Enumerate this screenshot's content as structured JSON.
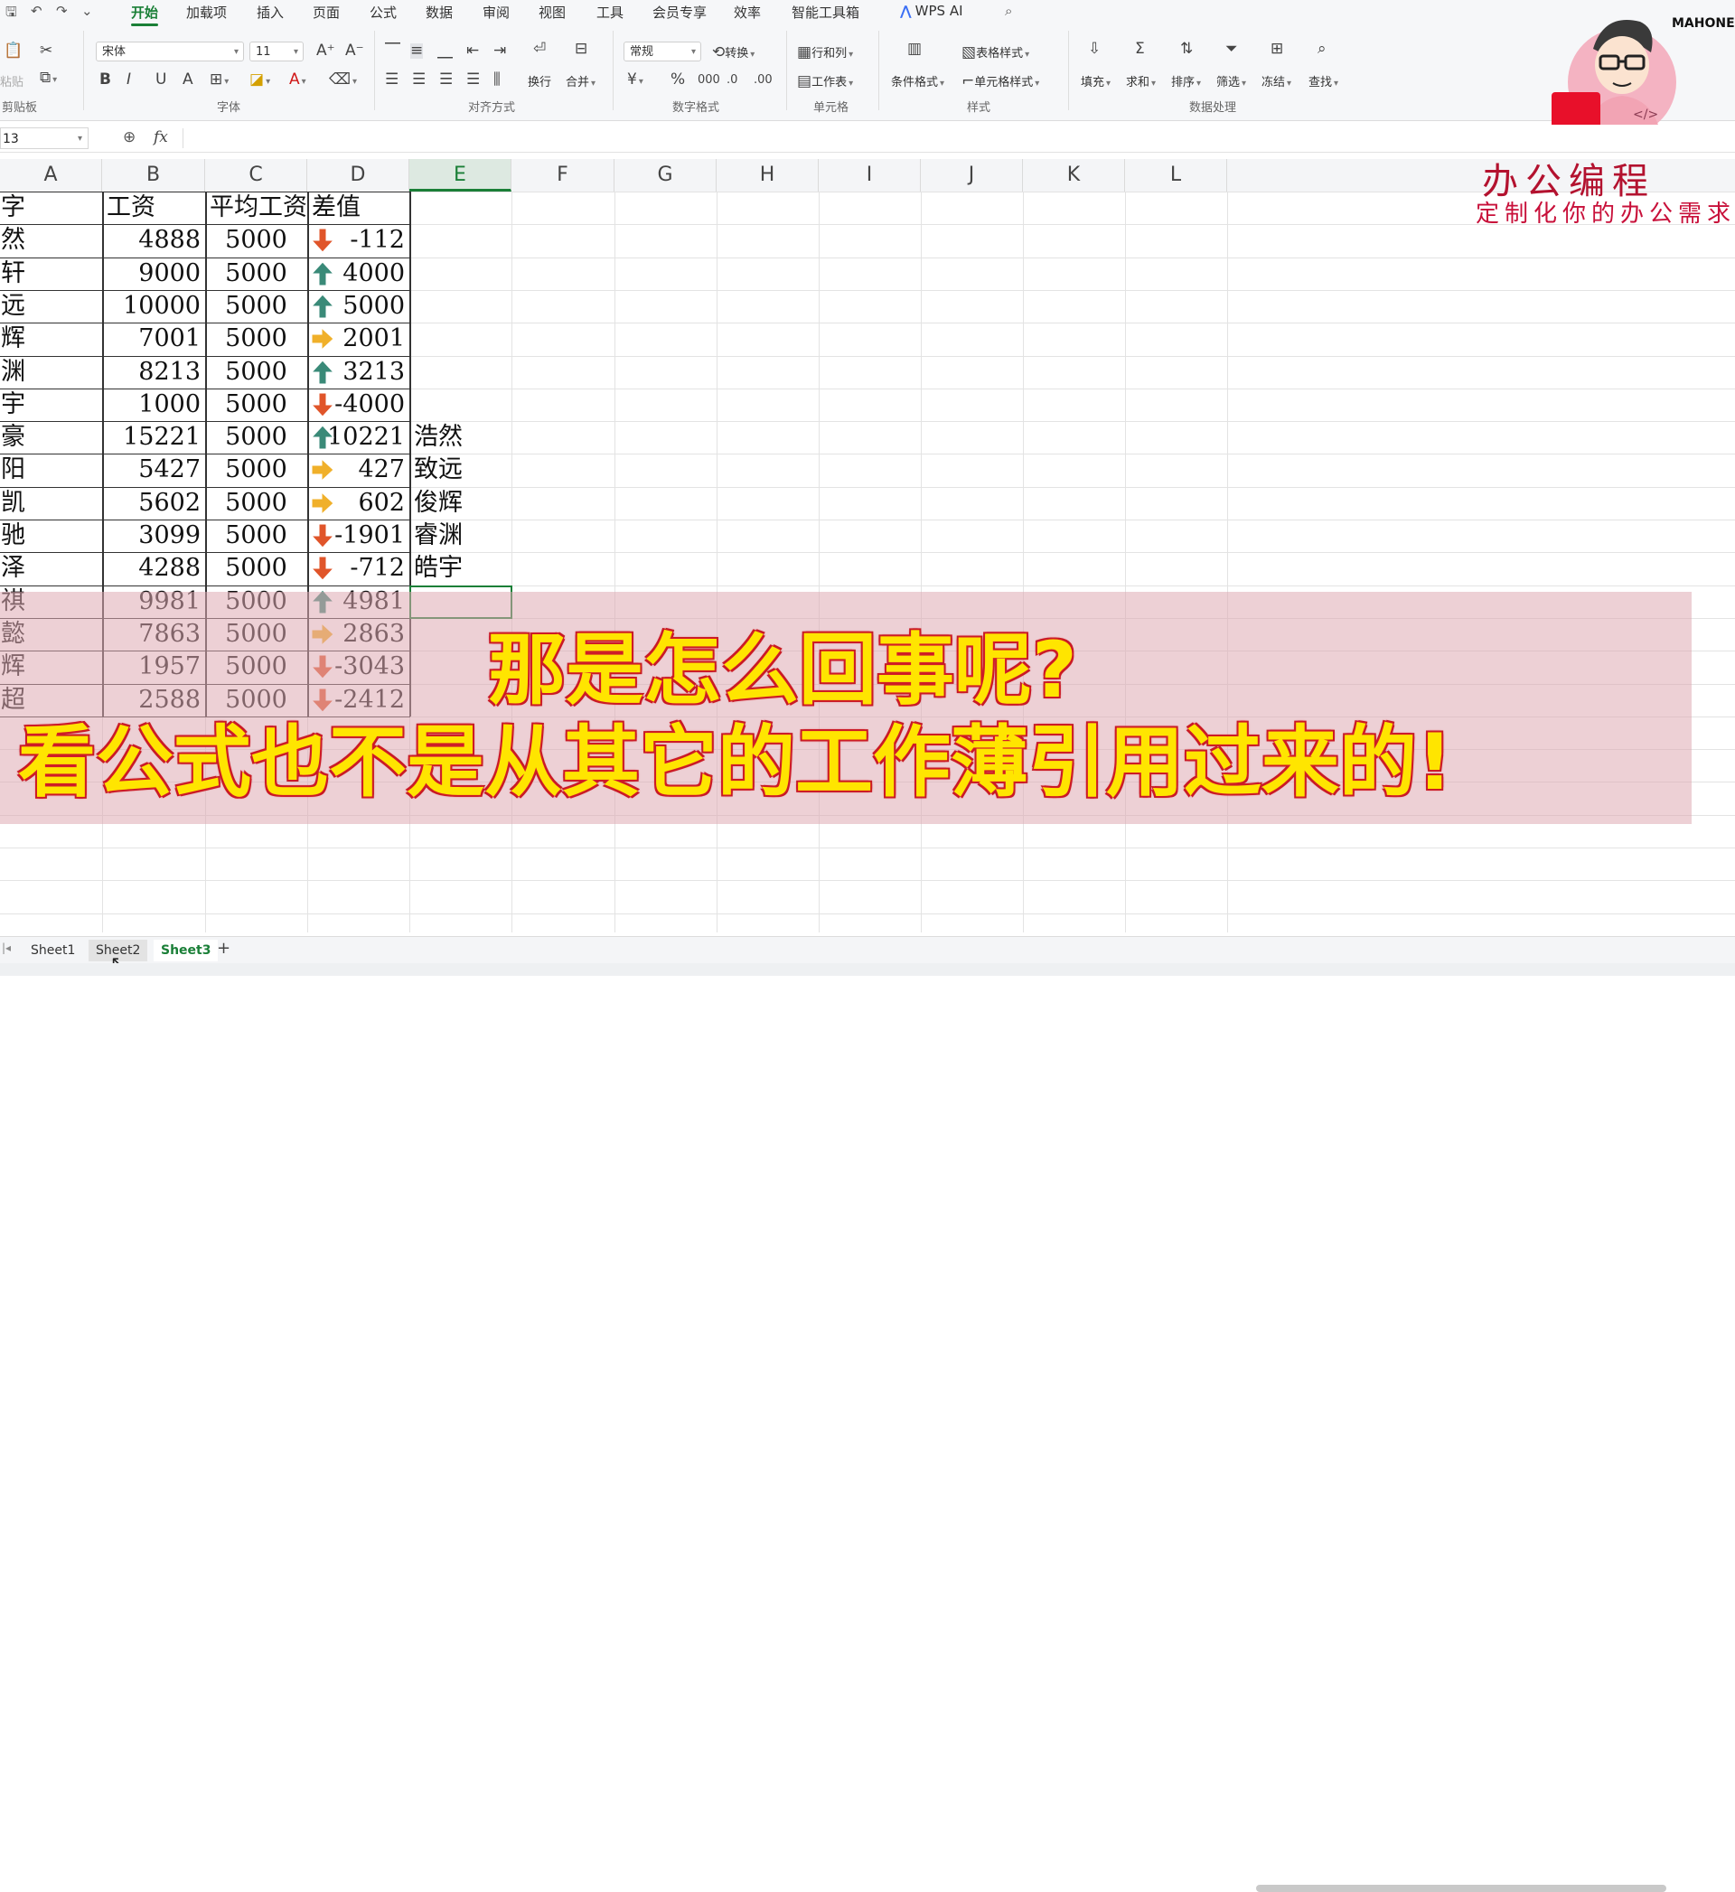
{
  "ribbon": {
    "tabs": [
      "开始",
      "加载项",
      "插入",
      "页面",
      "公式",
      "数据",
      "审阅",
      "视图",
      "工具",
      "会员专享",
      "效率",
      "智能工具箱"
    ],
    "active_tab": "开始",
    "wps_ai": "WPS AI",
    "font_name": "宋体",
    "font_size": "11",
    "number_format": "常规",
    "labels": {
      "paste": "粘贴",
      "clipboard": "剪贴板",
      "font": "字体",
      "align": "对齐方式",
      "number": "数字格式",
      "cells": "单元格",
      "styles": "样式",
      "data": "数据处理",
      "convert": "转换",
      "rowcol": "行和列",
      "worksheet": "工作表",
      "wrap": "换行",
      "merge": "合并",
      "cond_format": "条件格式",
      "table_style": "表格样式",
      "cell_style": "单元格样式",
      "fill": "填充",
      "sum": "求和",
      "sort": "排序",
      "filter": "筛选",
      "freeze": "冻结",
      "find": "查找"
    }
  },
  "formula_bar": {
    "name_box": "13",
    "fx": "fx"
  },
  "columns": [
    "A",
    "B",
    "C",
    "D",
    "E",
    "F",
    "G",
    "H",
    "I",
    "J",
    "K",
    "L"
  ],
  "selected_column": "E",
  "header_row": [
    "名字",
    "工资",
    "平均工资",
    "差值"
  ],
  "rows": [
    {
      "name": "浩然",
      "salary": "4888",
      "avg": "5000",
      "diff": "-112",
      "trend": "down"
    },
    {
      "name": "宇轩",
      "salary": "9000",
      "avg": "5000",
      "diff": "4000",
      "trend": "up"
    },
    {
      "name": "致远",
      "salary": "10000",
      "avg": "5000",
      "diff": "5000",
      "trend": "up"
    },
    {
      "name": "俊辉",
      "salary": "7001",
      "avg": "5000",
      "diff": "2001",
      "trend": "flat"
    },
    {
      "name": "睿渊",
      "salary": "8213",
      "avg": "5000",
      "diff": "3213",
      "trend": "up"
    },
    {
      "name": "皓宇",
      "salary": "1000",
      "avg": "5000",
      "diff": "-4000",
      "trend": "down"
    },
    {
      "name": "梓豪",
      "salary": "15221",
      "avg": "5000",
      "diff": "10221",
      "trend": "up"
    },
    {
      "name": "昊阳",
      "salary": "5427",
      "avg": "5000",
      "diff": "427",
      "trend": "flat"
    },
    {
      "name": "泽凯",
      "salary": "5602",
      "avg": "5000",
      "diff": "602",
      "trend": "flat"
    },
    {
      "name": "俊驰",
      "salary": "3099",
      "avg": "5000",
      "diff": "-1901",
      "trend": "down"
    },
    {
      "name": "雨泽",
      "salary": "4288",
      "avg": "5000",
      "diff": "-712",
      "trend": "down"
    },
    {
      "name": "浩祺",
      "salary": "9981",
      "avg": "5000",
      "diff": "4981",
      "trend": "up"
    },
    {
      "name": "嘉懿",
      "salary": "7863",
      "avg": "5000",
      "diff": "2863",
      "trend": "flat"
    },
    {
      "name": "明辉",
      "salary": "1957",
      "avg": "5000",
      "diff": "-3043",
      "trend": "down"
    },
    {
      "name": "浩超",
      "salary": "2588",
      "avg": "5000",
      "diff": "-2412",
      "trend": "down"
    }
  ],
  "column_e_values": [
    "",
    "",
    "",
    "",
    "",
    "",
    "浩然",
    "致远",
    "俊辉",
    "睿渊",
    "皓宇",
    "",
    "",
    "",
    ""
  ],
  "brand": {
    "title": "办公编程",
    "subtitle": "定制化你的办公需求",
    "user": "MAHONES"
  },
  "caption": {
    "line1": "那是怎么回事呢?",
    "line2": "看公式也不是从其它的工作薄引用过来的!"
  },
  "sheets": [
    "Sheet1",
    "Sheet2",
    "Sheet3"
  ],
  "active_sheet": "Sheet3",
  "add_sheet": "+",
  "colors": {
    "up": "#3a8a78",
    "down": "#e0552a",
    "flat": "#f0b02a",
    "accent": "#1a7f37",
    "brand": "#b3122f",
    "caption": "#ffe500"
  }
}
